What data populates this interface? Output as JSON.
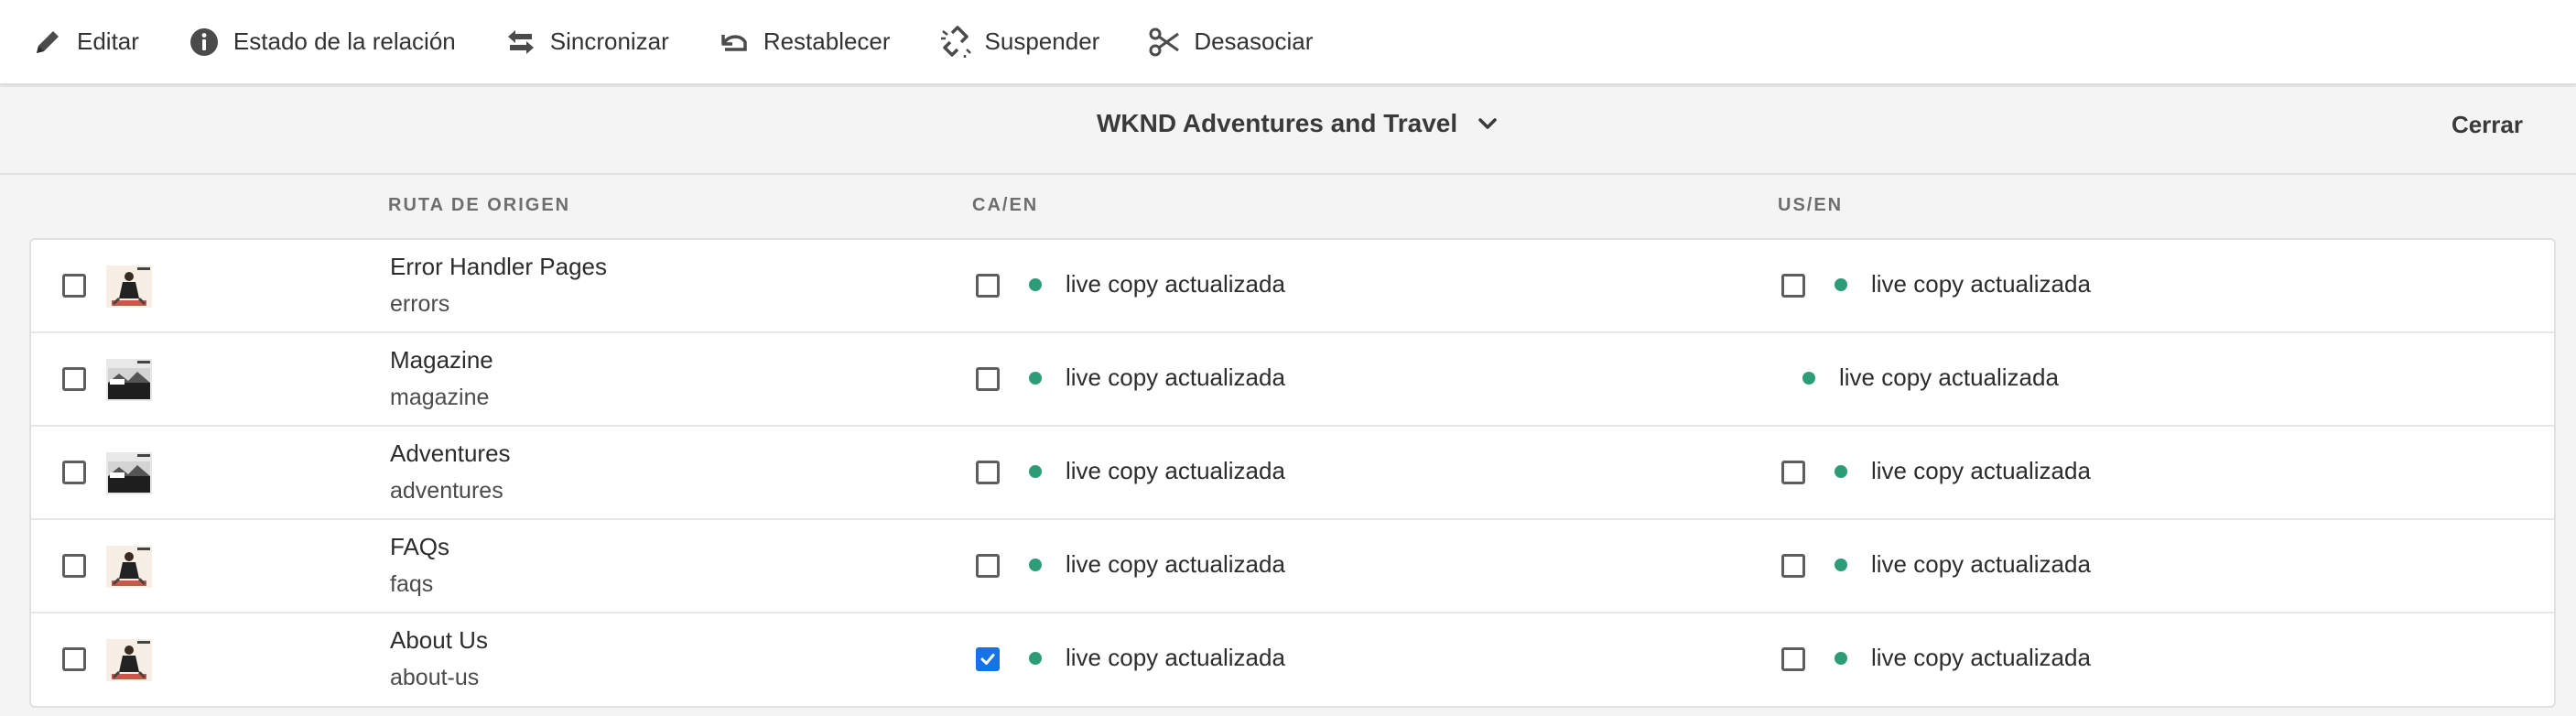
{
  "toolbar": {
    "items": [
      {
        "label": "Editar",
        "icon": "pencil-icon"
      },
      {
        "label": "Estado de la relación",
        "icon": "info-icon"
      },
      {
        "label": "Sincronizar",
        "icon": "sync-arrows-icon"
      },
      {
        "label": "Restablecer",
        "icon": "undo-icon"
      },
      {
        "label": "Suspender",
        "icon": "broken-link-icon"
      },
      {
        "label": "Desasociar",
        "icon": "scissors-icon"
      }
    ]
  },
  "header": {
    "site_title": "WKND Adventures and Travel",
    "close_label": "Cerrar"
  },
  "columns": {
    "source": "RUTA DE ORIGEN",
    "ca": "CA/EN",
    "us": "US/EN"
  },
  "status_color": "#2d9d78",
  "accent_color": "#1473e6",
  "rows": [
    {
      "title": "Error Handler Pages",
      "path": "errors",
      "thumb": "person-thumb",
      "ca": {
        "status": "live copy actualizada",
        "has_checkbox": true,
        "checked": false
      },
      "us": {
        "status": "live copy actualizada",
        "has_checkbox": true,
        "checked": false
      }
    },
    {
      "title": "Magazine",
      "path": "magazine",
      "thumb": "landscape-thumb",
      "ca": {
        "status": "live copy actualizada",
        "has_checkbox": true,
        "checked": false
      },
      "us": {
        "status": "live copy actualizada",
        "has_checkbox": false,
        "checked": false
      }
    },
    {
      "title": "Adventures",
      "path": "adventures",
      "thumb": "landscape-thumb",
      "ca": {
        "status": "live copy actualizada",
        "has_checkbox": true,
        "checked": false
      },
      "us": {
        "status": "live copy actualizada",
        "has_checkbox": true,
        "checked": false
      }
    },
    {
      "title": "FAQs",
      "path": "faqs",
      "thumb": "person-thumb",
      "ca": {
        "status": "live copy actualizada",
        "has_checkbox": true,
        "checked": false
      },
      "us": {
        "status": "live copy actualizada",
        "has_checkbox": true,
        "checked": false
      }
    },
    {
      "title": "About Us",
      "path": "about-us",
      "thumb": "person-thumb",
      "ca": {
        "status": "live copy actualizada",
        "has_checkbox": true,
        "checked": true
      },
      "us": {
        "status": "live copy actualizada",
        "has_checkbox": true,
        "checked": false
      }
    }
  ]
}
